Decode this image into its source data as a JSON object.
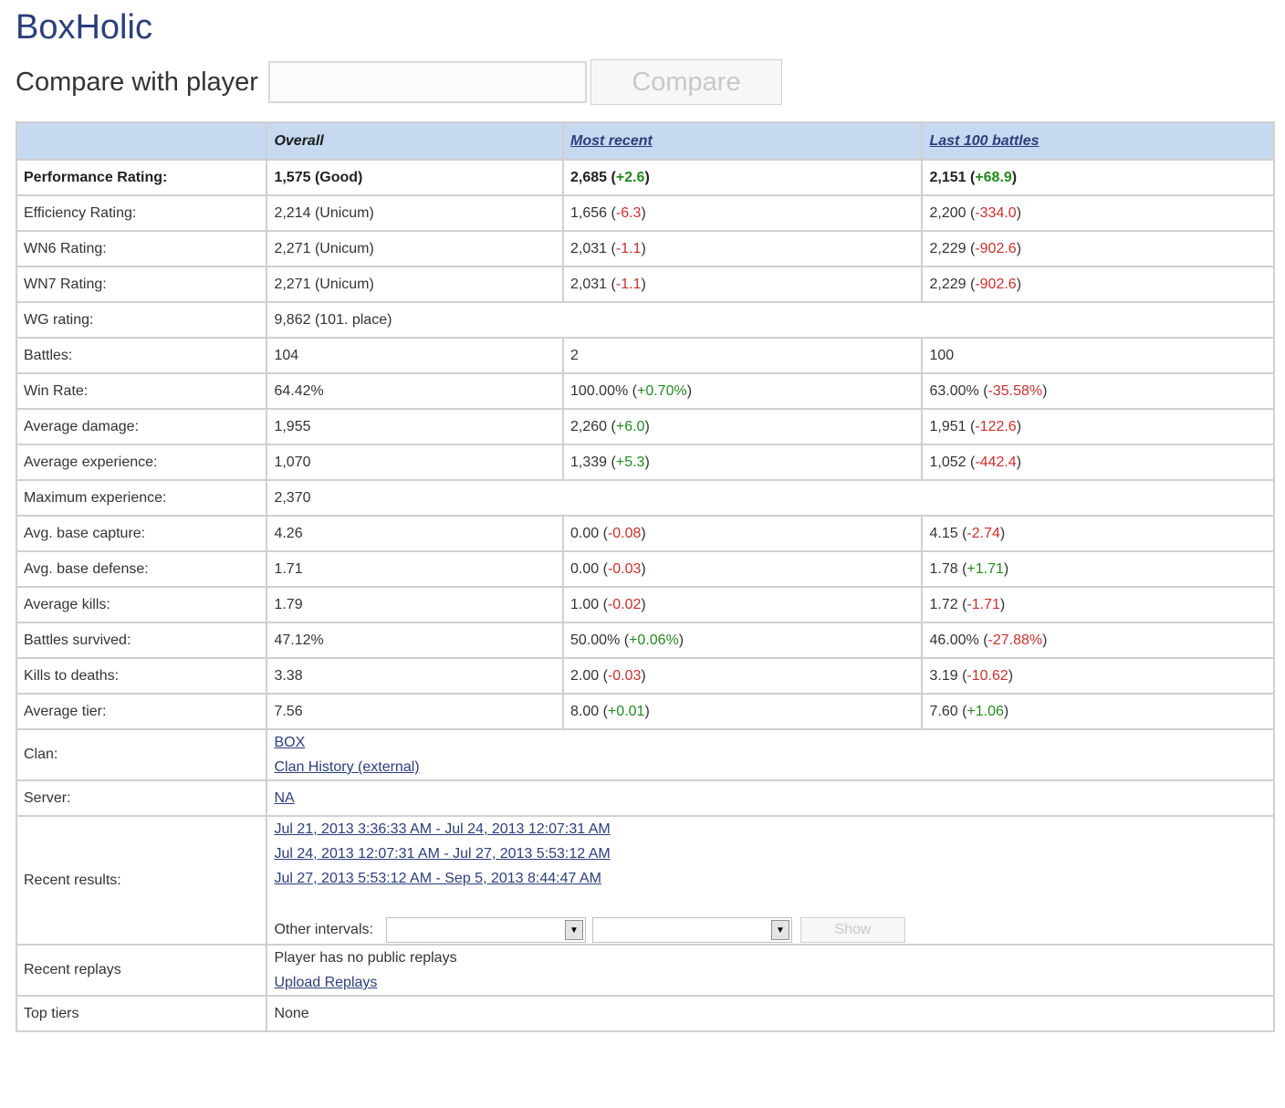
{
  "player_name": "BoxHolic",
  "compare": {
    "label": "Compare with player",
    "input_value": "",
    "button_label": "Compare"
  },
  "headers": {
    "col0": "",
    "overall": "Overall",
    "most_recent": "Most recent",
    "last100": "Last 100 battles"
  },
  "rows": {
    "perf": {
      "label": "Performance Rating:",
      "overall": "1,575 (Good)",
      "recent_value": "2,685",
      "recent_delta": "+2.6",
      "last100_value": "2,151",
      "last100_delta": "+68.9"
    },
    "eff": {
      "label": "Efficiency Rating:",
      "overall": "2,214 (Unicum)",
      "recent_value": "1,656",
      "recent_delta": "-6.3",
      "last100_value": "2,200",
      "last100_delta": "-334.0"
    },
    "wn6": {
      "label": "WN6 Rating:",
      "overall": "2,271 (Unicum)",
      "recent_value": "2,031",
      "recent_delta": "-1.1",
      "last100_value": "2,229",
      "last100_delta": "-902.6"
    },
    "wn7": {
      "label": "WN7 Rating:",
      "overall": "2,271 (Unicum)",
      "recent_value": "2,031",
      "recent_delta": "-1.1",
      "last100_value": "2,229",
      "last100_delta": "-902.6"
    },
    "wg": {
      "label": "WG rating:",
      "overall": "9,862 (101. place)"
    },
    "battles": {
      "label": "Battles:",
      "overall": "104",
      "recent_value": "2",
      "last100_value": "100"
    },
    "winrate": {
      "label": "Win Rate:",
      "overall": "64.42%",
      "recent_value": "100.00%",
      "recent_delta": "+0.70%",
      "last100_value": "63.00%",
      "last100_delta": "-35.58%"
    },
    "avgdmg": {
      "label": "Average damage:",
      "overall": "1,955",
      "recent_value": "2,260",
      "recent_delta": "+6.0",
      "last100_value": "1,951",
      "last100_delta": "-122.6"
    },
    "avgexp": {
      "label": "Average experience:",
      "overall": "1,070",
      "recent_value": "1,339",
      "recent_delta": "+5.3",
      "last100_value": "1,052",
      "last100_delta": "-442.4"
    },
    "maxexp": {
      "label": "Maximum experience:",
      "overall": "2,370"
    },
    "cap": {
      "label": "Avg. base capture:",
      "overall": "4.26",
      "recent_value": "0.00",
      "recent_delta": "-0.08",
      "last100_value": "4.15",
      "last100_delta": "-2.74"
    },
    "def": {
      "label": "Avg. base defense:",
      "overall": "1.71",
      "recent_value": "0.00",
      "recent_delta": "-0.03",
      "last100_value": "1.78",
      "last100_delta": "+1.71"
    },
    "kills": {
      "label": "Average kills:",
      "overall": "1.79",
      "recent_value": "1.00",
      "recent_delta": "-0.02",
      "last100_value": "1.72",
      "last100_delta": "-1.71"
    },
    "survived": {
      "label": "Battles survived:",
      "overall": "47.12%",
      "recent_value": "50.00%",
      "recent_delta": "+0.06%",
      "last100_value": "46.00%",
      "last100_delta": "-27.88%"
    },
    "kd": {
      "label": "Kills to deaths:",
      "overall": "3.38",
      "recent_value": "2.00",
      "recent_delta": "-0.03",
      "last100_value": "3.19",
      "last100_delta": "-10.62"
    },
    "tier": {
      "label": "Average tier:",
      "overall": "7.56",
      "recent_value": "8.00",
      "recent_delta": "+0.01",
      "last100_value": "7.60",
      "last100_delta": "+1.06"
    }
  },
  "clan": {
    "label": "Clan:",
    "name": "BOX",
    "history_link": "Clan History (external)"
  },
  "server": {
    "label": "Server:",
    "value": "NA"
  },
  "recent_results": {
    "label": "Recent results:",
    "links": [
      "Jul 21, 2013 3:36:33 AM - Jul 24, 2013 12:07:31 AM",
      "Jul 24, 2013 12:07:31 AM - Jul 27, 2013 5:53:12 AM",
      "Jul 27, 2013 5:53:12 AM - Sep 5, 2013 8:44:47 AM"
    ],
    "other_intervals_label": "Other intervals:",
    "select_from_value": "",
    "select_to_value": "",
    "show_button_label": "Show"
  },
  "replays": {
    "label": "Recent replays",
    "message": "Player has no public replays",
    "upload_link": "Upload Replays"
  },
  "top_tiers": {
    "label": "Top tiers",
    "value": "None"
  },
  "colors": {
    "positive": "#23891f",
    "negative": "#c9302c",
    "header_bg": "#c6d9f0",
    "title": "#2b3e7c"
  }
}
